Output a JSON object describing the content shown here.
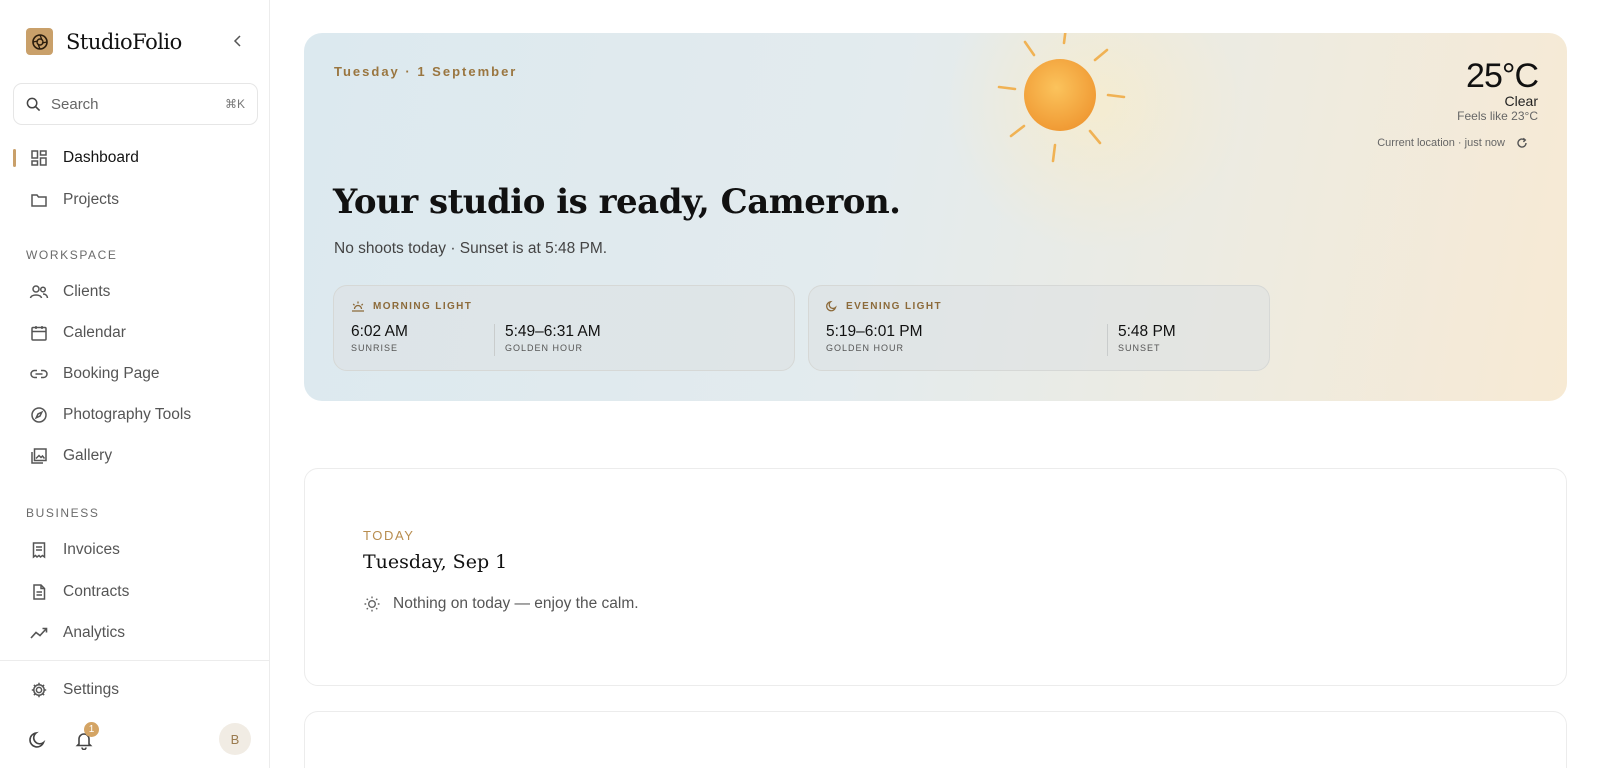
{
  "brand": {
    "name": "StudioFolio"
  },
  "search": {
    "placeholder": "Search",
    "shortcut": "⌘K"
  },
  "sidebar": {
    "primary": [
      {
        "label": "Dashboard",
        "icon": "dashboard-icon",
        "active": true
      },
      {
        "label": "Projects",
        "icon": "folder-icon"
      }
    ],
    "workspace_label": "WORKSPACE",
    "workspace": [
      {
        "label": "Clients",
        "icon": "users-icon"
      },
      {
        "label": "Calendar",
        "icon": "calendar-icon"
      },
      {
        "label": "Booking Page",
        "icon": "link-icon"
      },
      {
        "label": "Photography Tools",
        "icon": "compass-icon"
      },
      {
        "label": "Gallery",
        "icon": "gallery-icon"
      }
    ],
    "business_label": "BUSINESS",
    "business": [
      {
        "label": "Invoices",
        "icon": "invoice-icon"
      },
      {
        "label": "Contracts",
        "icon": "contract-icon"
      },
      {
        "label": "Analytics",
        "icon": "analytics-icon"
      }
    ],
    "settings_label": "Settings",
    "notifications_count": "1",
    "avatar_initial": "B"
  },
  "hero": {
    "date": "Tuesday · 1 September",
    "temperature": "25°C",
    "condition": "Clear",
    "feels_like": "Feels like 23°C",
    "location": "Current location · just now",
    "title": "Your studio is ready, Cameron.",
    "subtitle": "No shoots today · Sunset is at 5:48 PM.",
    "morning": {
      "title": "MORNING LIGHT",
      "first_time": "6:02 AM",
      "first_caption": "SUNRISE",
      "second_time": "5:49–6:31 AM",
      "second_caption": "GOLDEN HOUR"
    },
    "evening": {
      "title": "EVENING LIGHT",
      "first_time": "5:19–6:01 PM",
      "first_caption": "GOLDEN HOUR",
      "second_time": "5:48 PM",
      "second_caption": "SUNSET"
    }
  },
  "today": {
    "label": "TODAY",
    "date": "Tuesday, Sep 1",
    "empty_message": "Nothing on today — enjoy the calm."
  },
  "colors": {
    "accent": "#c9a06a",
    "accent_text": "#b88d4f",
    "sun": "#f3a43a"
  }
}
